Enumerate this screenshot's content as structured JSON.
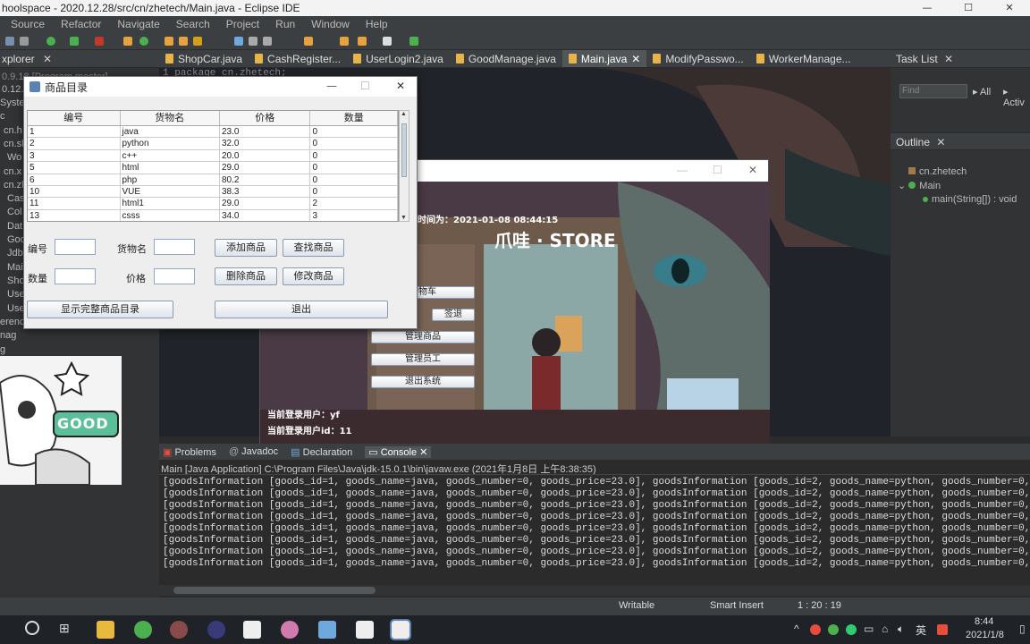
{
  "window": {
    "title": "hoolspace - 2020.12.28/src/cn/zhetech/Main.java - Eclipse IDE"
  },
  "menu": [
    "Source",
    "Refactor",
    "Navigate",
    "Search",
    "Project",
    "Run",
    "Window",
    "Help"
  ],
  "left_panel": {
    "title": "xplorer",
    "items": [
      "0.9.18 [Program master]",
      "0.12.2",
      "Syste",
      "c",
      "cn.h",
      "cn.sl",
      "Wo",
      "cn.x",
      "cn.zl",
      "Cas",
      "Col",
      "Dat",
      "Goo",
      "Jdb",
      "Mai",
      "Sho",
      "Use",
      "Use",
      "erenc",
      "nag",
      "g"
    ]
  },
  "editor_tabs": [
    "ShopCar.java",
    "CashRegister...",
    "UserLogin2.java",
    "GoodManage.java",
    "Main.java",
    "ModifyPasswo...",
    "WorkerManage..."
  ],
  "editor_code": "1  package cn.zhetech;",
  "task_list": {
    "title": "Task List",
    "find_placeholder": "Find",
    "all": "All",
    "activate": "Activ"
  },
  "outline": {
    "title": "Outline",
    "items": [
      "cn.zhetech",
      "Main",
      "main(String[]) : void"
    ]
  },
  "goods_window": {
    "title": "商品目录",
    "columns": [
      "编号",
      "货物名",
      "价格",
      "数量"
    ],
    "rows": [
      [
        "1",
        "java",
        "23.0",
        "0"
      ],
      [
        "2",
        "python",
        "32.0",
        "0"
      ],
      [
        "3",
        "c++",
        "20.0",
        "0"
      ],
      [
        "5",
        "html",
        "29.0",
        "0"
      ],
      [
        "6",
        "php",
        "80.2",
        "0"
      ],
      [
        "10",
        "VUE",
        "38.3",
        "0"
      ],
      [
        "11",
        "html1",
        "29.0",
        "2"
      ],
      [
        "13",
        "csss",
        "34.0",
        "3"
      ]
    ],
    "labels": {
      "id": "编号",
      "name": "货物名",
      "quantity": "数量",
      "price": "价格"
    },
    "buttons": {
      "add": "添加商品",
      "find": "查找商品",
      "delete": "删除商品",
      "modify": "修改商品",
      "show_all": "显示完整商品目录",
      "exit": "退出"
    }
  },
  "shop_window": {
    "time_label": "时间为：2021-01-08 08:44:15",
    "store_sign": "爪哇 · STORE",
    "buttons": [
      "购物车",
      "签退",
      "管理商品",
      "管理员工",
      "退出系统"
    ],
    "current_user": "当前登录用户：yf",
    "current_user_id": "当前登录用户id：11"
  },
  "bottom": {
    "tabs": [
      "Problems",
      "Javadoc",
      "Declaration",
      "Console"
    ],
    "launch": "Main [Java Application] C:\\Program Files\\Java\\jdk-15.0.1\\bin\\javaw.exe  (2021年1月8日 上午8:38:35)",
    "console_line": "[goodsInformation [goods_id=1, goods_name=java, goods_number=0, goods_price=23.0], goodsInformation [goods_id=2, goods_name=python, goods_number=0, goods_price=32"
  },
  "status": {
    "writable": "Writable",
    "insert": "Smart Insert",
    "position": "1 : 20 : 19"
  },
  "taskbar": {
    "time": "8:44",
    "date": "2021/1/8",
    "ime": "英"
  }
}
